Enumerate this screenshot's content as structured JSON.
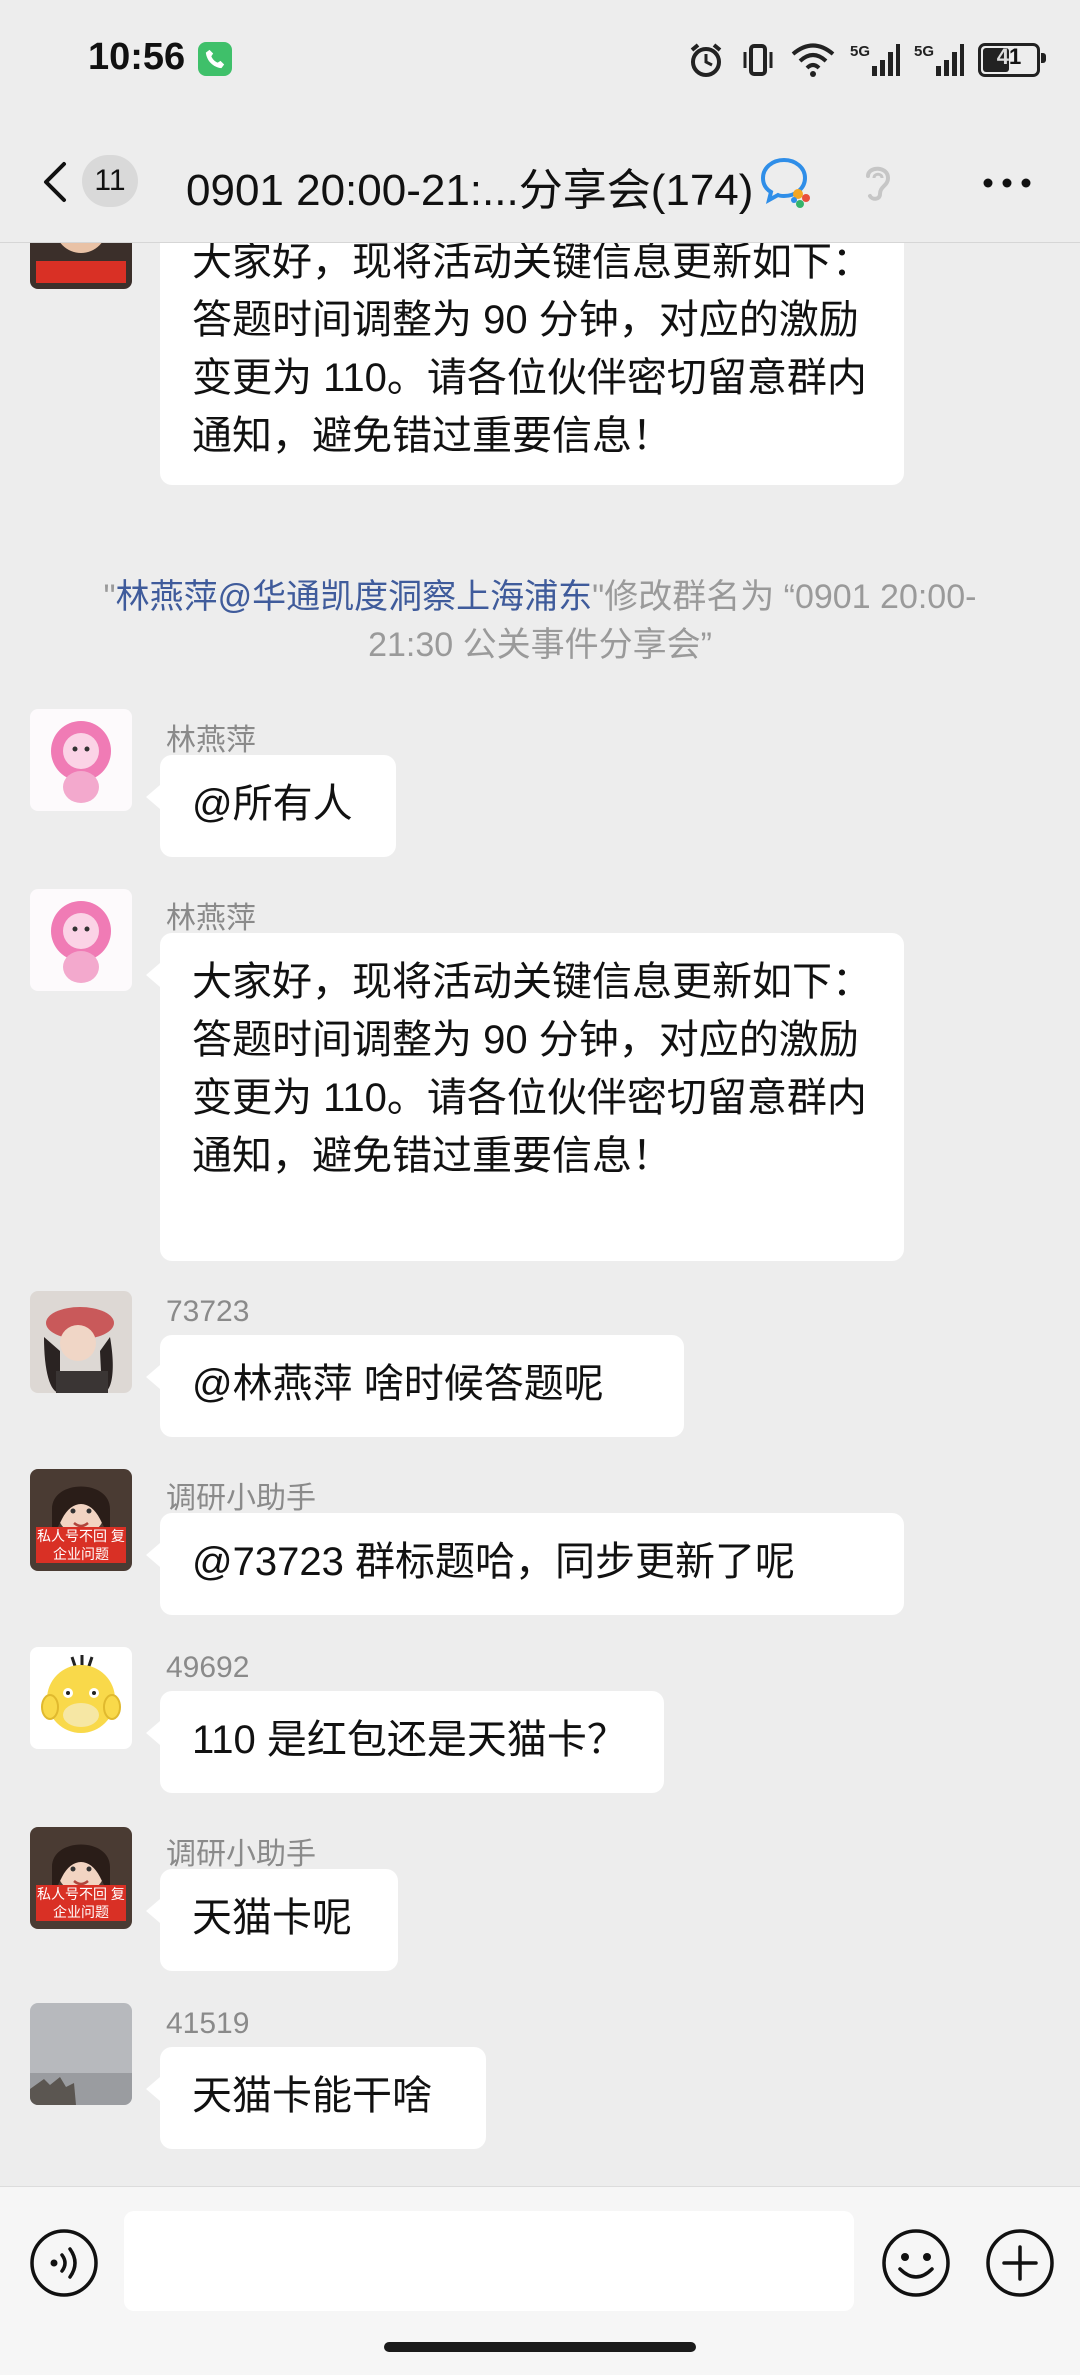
{
  "status_bar": {
    "time": "10:56",
    "battery": "41",
    "network_a": "5G",
    "network_b": "5G"
  },
  "nav": {
    "unread_count": "11",
    "title": "0901 20:00-21:...分享会(174)"
  },
  "messages": {
    "top_partial_text": "大家好，现将活动关键信息更新如下：答题时间调整为 90 分钟，对应的激励变更为 110。请各位伙伴密切留意群内通知，避免错过重要信息！",
    "system": {
      "quote_open": "\"",
      "actor": "林燕萍@华通凯度洞察上海浦东",
      "rest": "\"修改群名为 “0901 20:00-21:30 公关事件分享会”"
    },
    "m1": {
      "sender": "林燕萍",
      "text": "@所有人"
    },
    "m2": {
      "sender": "林燕萍",
      "text": "大家好，现将活动关键信息更新如下：答题时间调整为 90 分钟，对应的激励变更为 110。请各位伙伴密切留意群内通知，避免错过重要信息！"
    },
    "m3": {
      "sender": "73723",
      "text": "@林燕萍  啥时候答题呢"
    },
    "m4": {
      "sender": "调研小助手",
      "text": "@73723  群标题哈，同步更新了呢",
      "avatar_tag": "私人号不回 复企业问题"
    },
    "m5": {
      "sender": "49692",
      "text": "110 是红包还是天猫卡？"
    },
    "m6": {
      "sender": "调研小助手",
      "text": "天猫卡呢",
      "avatar_tag": "私人号不回 复企业问题"
    },
    "m7": {
      "sender": "41519",
      "text": "天猫卡能干啥"
    }
  },
  "colors": {
    "background": "#ededed",
    "bubble": "#ffffff",
    "link": "#3f5b9b",
    "call_green": "#3fc06a"
  },
  "icons": [
    "back-icon",
    "wecom-icon",
    "ear-icon",
    "more-icon",
    "voice-icon",
    "emoji-icon",
    "plus-icon",
    "alarm-icon",
    "vibrate-icon",
    "wifi-icon",
    "signal-icon",
    "phone-call-icon"
  ]
}
